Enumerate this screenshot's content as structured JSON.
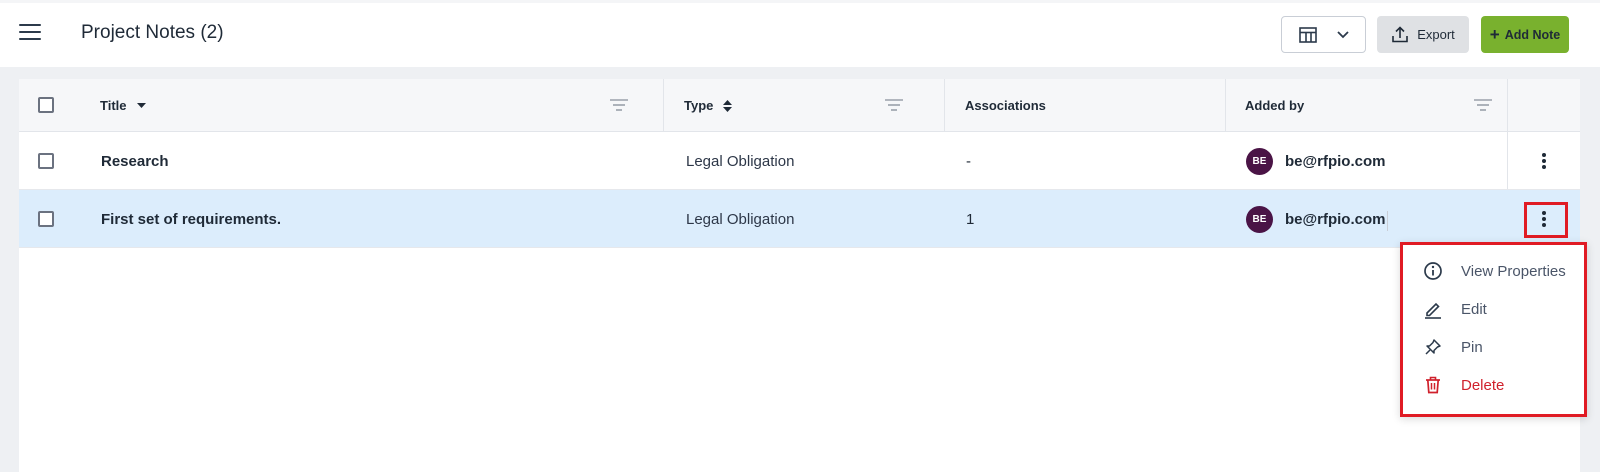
{
  "header": {
    "title": "Project Notes (2)",
    "export_label": "Export",
    "add_note_label": "Add Note"
  },
  "table": {
    "columns": [
      "Title",
      "Type",
      "Associations",
      "Added by"
    ],
    "rows": [
      {
        "title": "Research",
        "type": "Legal Obligation",
        "associations": "-",
        "avatar": "BE",
        "added_by": "be@rfpio.com",
        "selected": false
      },
      {
        "title": "First set of requirements.",
        "type": "Legal Obligation",
        "associations": "1",
        "avatar": "BE",
        "added_by": "be@rfpio.com",
        "selected": true
      }
    ]
  },
  "menu": {
    "items": [
      {
        "label": "View Properties",
        "icon": "info-icon"
      },
      {
        "label": "Edit",
        "icon": "pencil-icon"
      },
      {
        "label": "Pin",
        "icon": "pin-icon"
      },
      {
        "label": "Delete",
        "icon": "trash-icon",
        "color": "#d0212c"
      }
    ]
  },
  "colors": {
    "accent_green": "#79b12e",
    "selected_row": "#dcedfc",
    "avatar": "#4a1446",
    "highlight_red": "#e01b24"
  }
}
